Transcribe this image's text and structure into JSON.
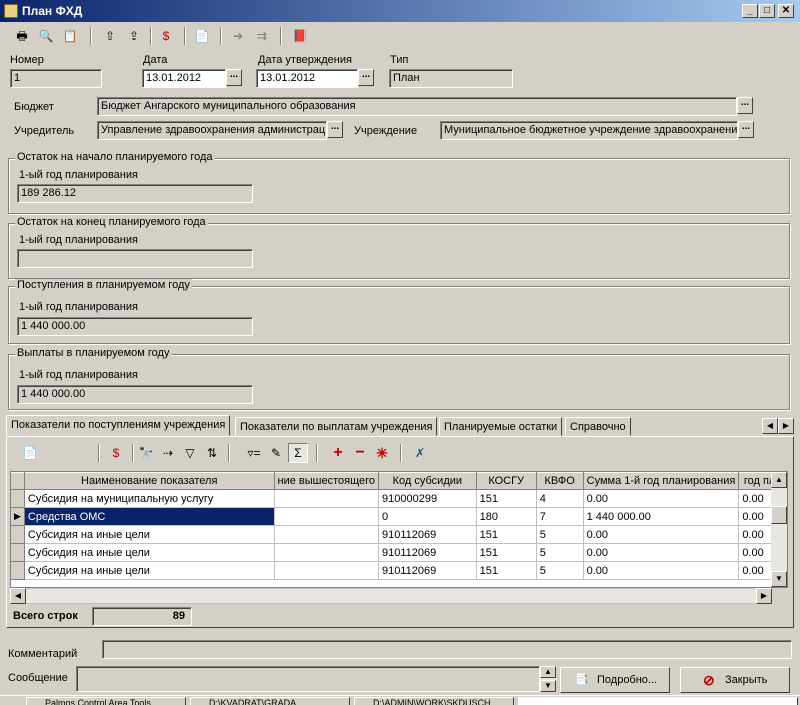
{
  "window": {
    "title": "План ФХД"
  },
  "header": {
    "number_label": "Номер",
    "number_value": "1",
    "date_label": "Дата",
    "date_value": "13.01.2012",
    "approve_label": "Дата утверждения",
    "approve_value": "13.01.2012",
    "type_label": "Тип",
    "type_value": "План",
    "budget_label": "Бюджет",
    "budget_value": "Бюджет Ангарского муниципального образования",
    "founder_label": "Учредитель",
    "founder_value": "Управление здравоохранения администрац",
    "institution_label": "Учреждение",
    "institution_value": "Муниципальное бюджетное учреждение здравоохранения"
  },
  "groups": [
    {
      "title": "Остаток на начало планируемого года",
      "sub": "1-ый год планирования",
      "value": "189 286.12"
    },
    {
      "title": "Остаток на конец планируемого года",
      "sub": "1-ый год планирования",
      "value": ""
    },
    {
      "title": "Поступления в планируемом году",
      "sub": "1-ый год планирования",
      "value": "1 440 000.00"
    },
    {
      "title": "Выплаты в планируемом году",
      "sub": "1-ый год планирования",
      "value": "1 440 000.00"
    }
  ],
  "tabs": [
    "Показатели по поступлениям учреждения",
    "Показатели по выплатам учреждения",
    "Планируемые остатки",
    "Справочно"
  ],
  "table": {
    "headers": [
      "Наименование показателя",
      "ние вышестоящего",
      "Код субсидии",
      "КОСГУ",
      "КВФО",
      "Сумма 1-й год планирования",
      "год пла"
    ],
    "rows": [
      [
        "Субсидия на муниципальную услугу",
        "",
        "910000299",
        "151",
        "4",
        "0.00",
        "0.00"
      ],
      [
        "Средства ОМС",
        "",
        "0",
        "180",
        "7",
        "1 440 000.00",
        "0.00"
      ],
      [
        "Субсидия на иные цели",
        "",
        "910112069",
        "151",
        "5",
        "0.00",
        "0.00"
      ],
      [
        "Субсидия на иные цели",
        "",
        "910112069",
        "151",
        "5",
        "0.00",
        "0.00"
      ],
      [
        "Субсидия на иные цели",
        "",
        "910112069",
        "151",
        "5",
        "0.00",
        "0.00"
      ]
    ],
    "total_label": "Всего строк",
    "total_value": "89"
  },
  "footer": {
    "comment_label": "Комментарий",
    "message_label": "Сообщение",
    "details_button": "Подробно...",
    "close_button": "Закрыть"
  },
  "taskbar": [
    "Palmos Control Area Tools",
    "D:\\KVADRAT\\GRADA",
    "D:\\ADMIN\\WORK\\SKDUSCH"
  ]
}
